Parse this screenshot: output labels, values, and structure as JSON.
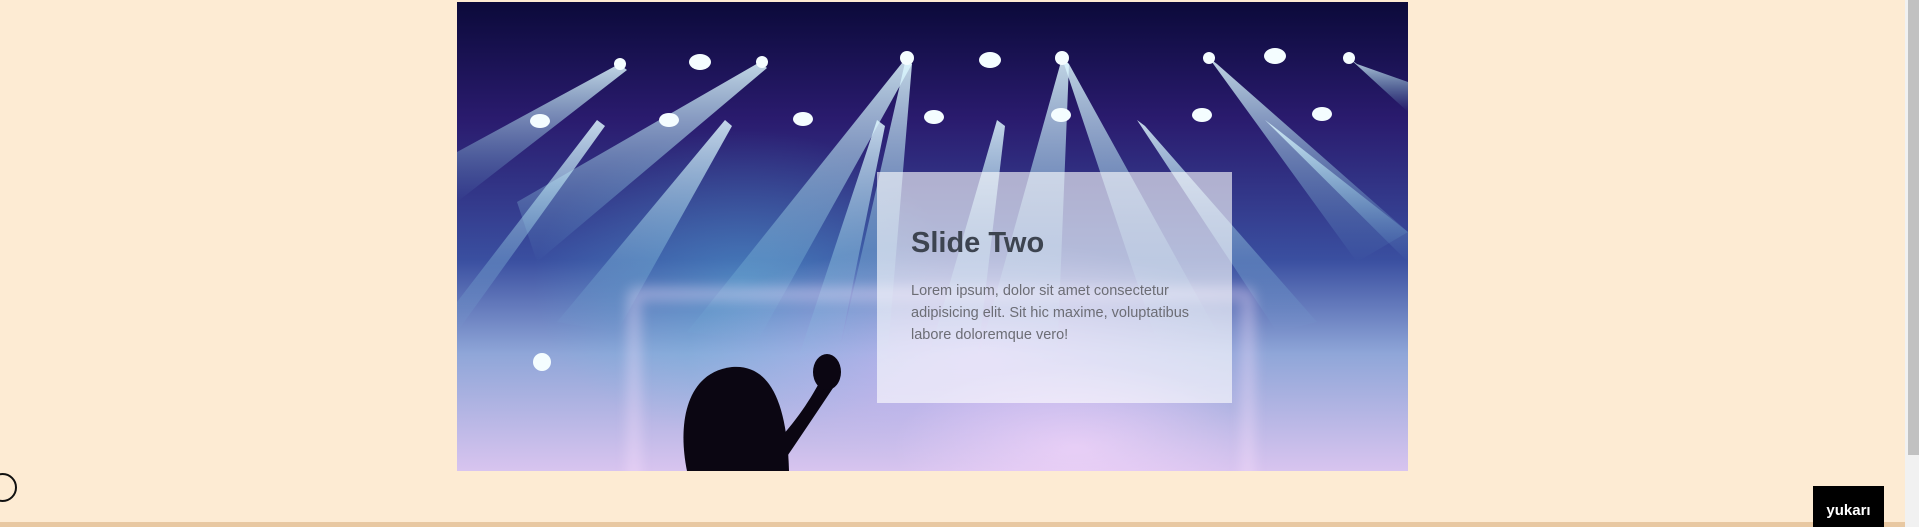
{
  "slide": {
    "title": "Slide Two",
    "text": "Lorem ipsum, dolor sit amet consectetur adipisicing elit. Sit hic maxime, voluptatibus labore doloremque vero!"
  },
  "top_button": {
    "label": "yukarı"
  },
  "colors": {
    "page_background": "#fdebd3",
    "caption_overlay": "#ffffff",
    "button_background": "#000000",
    "bottom_line": "#e8c8a2"
  }
}
